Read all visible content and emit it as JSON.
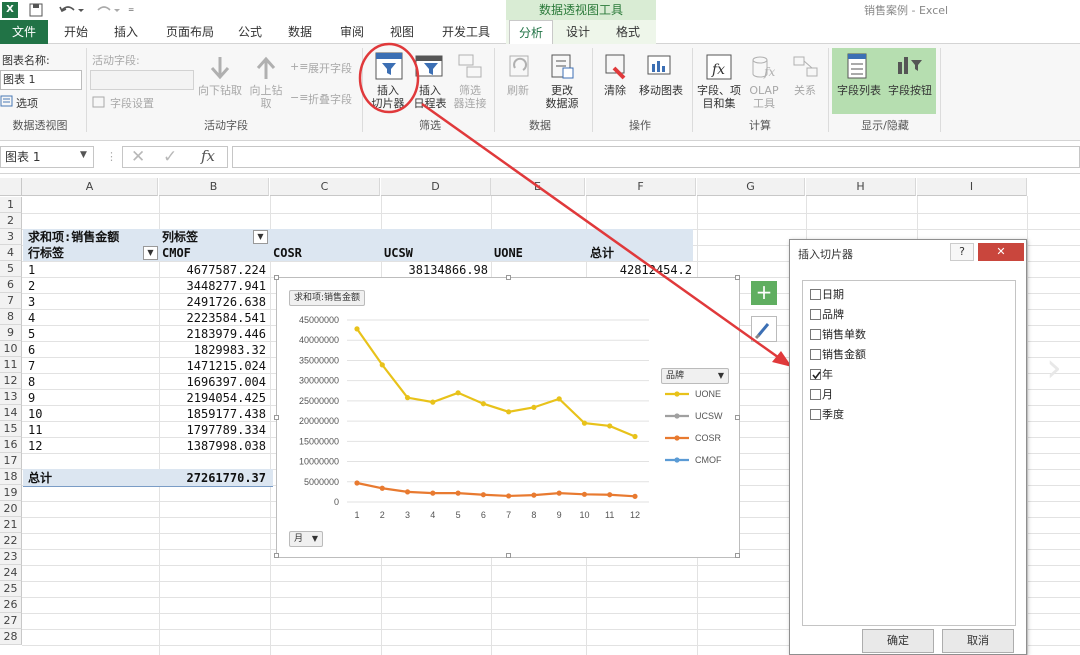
{
  "titlebar": {
    "doc_title": "销售案例 - Excel",
    "context_tools": "数据透视图工具",
    "quick_more": "₌"
  },
  "tabs": [
    "文件",
    "开始",
    "插入",
    "页面布局",
    "公式",
    "数据",
    "审阅",
    "视图",
    "开发工具",
    "分析",
    "设计",
    "格式"
  ],
  "ribbon": {
    "chart_name_label": "图表名称:",
    "chart_name_value": "图表 1",
    "options": "选项",
    "active_field_label": "活动字段:",
    "field_settings": "字段设置",
    "drill_down": "向下钻取",
    "drill_up": "向上钻",
    "drill_up2": "取",
    "expand_field": "展开字段",
    "collapse_field": "折叠字段",
    "insert_slicer": [
      "插入",
      "切片器"
    ],
    "insert_timeline": [
      "插入",
      "日程表"
    ],
    "filter_connections": [
      "筛选",
      "器连接"
    ],
    "refresh": "刷新",
    "change_source": [
      "更改",
      "数据源"
    ],
    "clear": "清除",
    "move_chart": "移动图表",
    "fields_items": [
      "字段、项",
      "目和集"
    ],
    "olap": [
      "OLAP",
      "工具"
    ],
    "relationships": "关系",
    "field_list": "字段列表",
    "field_buttons": "字段按钮",
    "groups": [
      "数据透视图",
      "活动字段",
      "筛选",
      "数据",
      "操作",
      "计算",
      "显示/隐藏"
    ]
  },
  "formula_bar": {
    "name_box": "图表 1",
    "fx": "fx",
    "value": ""
  },
  "columns": [
    "A",
    "B",
    "C",
    "D",
    "E",
    "F",
    "G",
    "H",
    "I"
  ],
  "rows": [
    "1",
    "2",
    "3",
    "4",
    "5",
    "6",
    "7",
    "8",
    "9",
    "10",
    "11",
    "12",
    "13",
    "14",
    "15",
    "16",
    "17",
    "18",
    "19",
    "20",
    "21",
    "22",
    "23",
    "24",
    "25",
    "26",
    "27",
    "28"
  ],
  "pivot": {
    "values_label": "求和项:销售金额",
    "col_labels": "列标签",
    "row_labels": "行标签",
    "brands": [
      "CMOF",
      "COSR",
      "UCSW",
      "UONE"
    ],
    "total_label": "总计",
    "rows": [
      {
        "k": "1",
        "cmof": "4677587.224",
        "ucsw": "38134866.98",
        "total": "42812454.2"
      },
      {
        "k": "2",
        "cmof": "3448277.941"
      },
      {
        "k": "3",
        "cmof": "2491726.638"
      },
      {
        "k": "4",
        "cmof": "2223584.541"
      },
      {
        "k": "5",
        "cmof": "2183979.446"
      },
      {
        "k": "6",
        "cmof": "1829983.32"
      },
      {
        "k": "7",
        "cmof": "1471215.024"
      },
      {
        "k": "8",
        "cmof": "1696397.004"
      },
      {
        "k": "9",
        "cmof": "2194054.425"
      },
      {
        "k": "10",
        "cmof": "1859177.438"
      },
      {
        "k": "11",
        "cmof": "1797789.334"
      },
      {
        "k": "12",
        "cmof": "1387998.038"
      }
    ],
    "grand_total": "27261770.37"
  },
  "chart": {
    "field_button": "求和项:销售金额",
    "axis_button": "月",
    "legend_button": "品牌"
  },
  "chart_data": {
    "type": "line",
    "x": [
      1,
      2,
      3,
      4,
      5,
      6,
      7,
      8,
      9,
      10,
      11,
      12
    ],
    "ylim": [
      0,
      45000000
    ],
    "yticks": [
      0,
      5000000,
      10000000,
      15000000,
      20000000,
      25000000,
      30000000,
      35000000,
      40000000,
      45000000
    ],
    "series": [
      {
        "name": "UONE",
        "color": "#e8c21a",
        "values": [
          42800000,
          33900000,
          25800000,
          24700000,
          27000000,
          24300000,
          22300000,
          23400000,
          25500000,
          19500000,
          18800000,
          16200000
        ]
      },
      {
        "name": "UCSW",
        "color": "#a0a0a0",
        "values": [
          null,
          null,
          null,
          null,
          null,
          null,
          null,
          null,
          null,
          null,
          null,
          null
        ]
      },
      {
        "name": "COSR",
        "color": "#e87a30",
        "values": [
          4700000,
          3400000,
          2500000,
          2200000,
          2200000,
          1800000,
          1500000,
          1700000,
          2200000,
          1900000,
          1800000,
          1400000
        ]
      },
      {
        "name": "CMOF",
        "color": "#5b9bd5",
        "values": [
          null,
          null,
          null,
          null,
          null,
          null,
          null,
          null,
          null,
          null,
          null,
          null
        ]
      }
    ],
    "grid": true,
    "legend_position": "right"
  },
  "dialog": {
    "title": "插入切片器",
    "help": "?",
    "close": "✕",
    "items": [
      {
        "label": "日期",
        "checked": false
      },
      {
        "label": "品牌",
        "checked": false
      },
      {
        "label": "销售单数",
        "checked": false
      },
      {
        "label": "销售金额",
        "checked": false
      },
      {
        "label": "年",
        "checked": true
      },
      {
        "label": "月",
        "checked": false
      },
      {
        "label": "季度",
        "checked": false
      }
    ],
    "ok": "确定",
    "cancel": "取消"
  },
  "colors": {
    "excel_green": "#217346",
    "annotation_red": "#e0393b",
    "pivot_band": "#dce6f1"
  }
}
